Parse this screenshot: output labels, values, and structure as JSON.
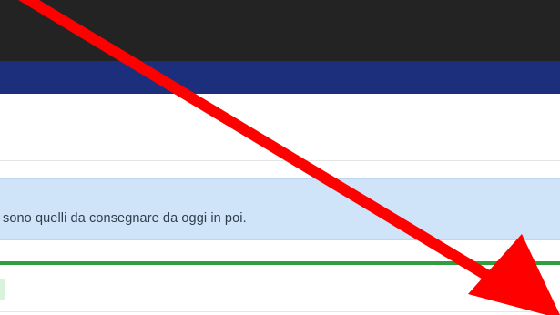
{
  "info_message": {
    "text": "sono quelli da consegnare da oggi in poi."
  },
  "colors": {
    "topbar": "#232323",
    "navbar": "#1b2f7d",
    "info_background": "#cfe4f8",
    "success_rule": "#2f9e3e",
    "annotation_arrow": "#ff0000"
  },
  "annotation": {
    "icon": "red-arrow-icon"
  }
}
